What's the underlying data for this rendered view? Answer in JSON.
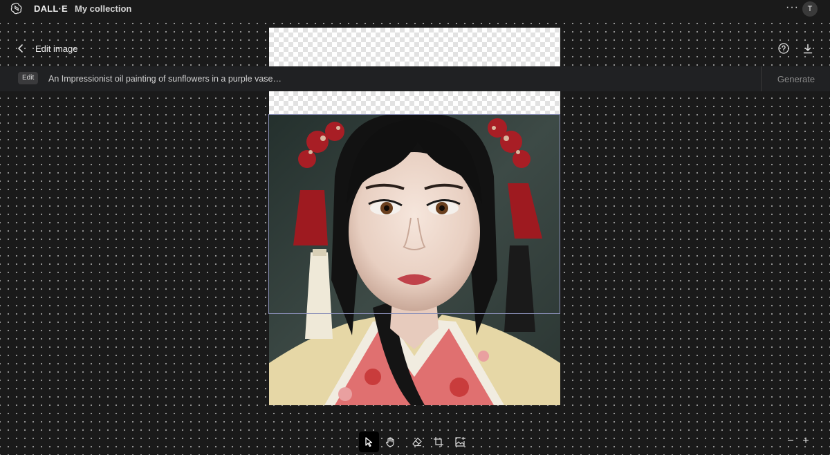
{
  "app": {
    "brand": "DALL·E",
    "collection_link": "My collection",
    "more_label": "···",
    "avatar_initial": "T"
  },
  "editor": {
    "title": "Edit image"
  },
  "prompt": {
    "badge": "Edit",
    "placeholder": "An Impressionist oil painting of sunflowers in a purple vase…",
    "value": "",
    "generate_label": "Generate"
  },
  "canvas": {
    "image_alt": "Portrait of a young woman with red hair ornaments and a kimono"
  },
  "toolbar": {
    "tools": [
      {
        "icon": "select-arrow-icon",
        "active": true
      },
      {
        "icon": "hand-icon",
        "active": false
      },
      {
        "icon": "eraser-icon",
        "active": false
      },
      {
        "icon": "crop-icon",
        "active": false
      },
      {
        "icon": "add-image-icon",
        "active": false
      }
    ]
  },
  "zoom": {
    "out_label": "−",
    "in_label": "+"
  },
  "colors": {
    "background": "#1a1a1a",
    "prompt_bar": "#202123",
    "selection_border": "#8a8fb8"
  }
}
